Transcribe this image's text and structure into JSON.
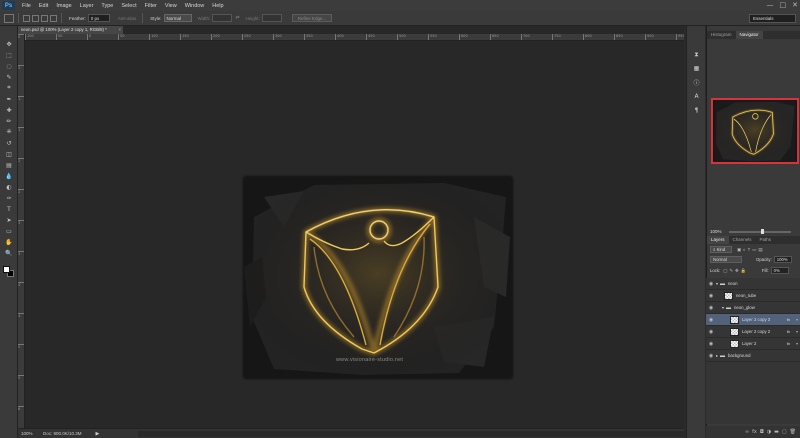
{
  "app": {
    "logo": "Ps",
    "window_controls": [
      "—",
      "□",
      "✕"
    ]
  },
  "menu": [
    "File",
    "Edit",
    "Image",
    "Layer",
    "Type",
    "Select",
    "Filter",
    "View",
    "Window",
    "Help"
  ],
  "options_bar": {
    "feather_label": "Feather:",
    "feather_value": "0 px",
    "anti_alias_label": "Anti-alias",
    "style_label": "Style:",
    "style_value": "Normal",
    "width_label": "Width:",
    "height_label": "Height:",
    "refine_edge_label": "Refine Edge...",
    "workspace": "Essentials"
  },
  "document": {
    "tab_title": "neon.psd @ 100% (Layer 2 copy 1, RGB/8) *",
    "watermark": "www.visionaire-studio.net",
    "zoom": "100%",
    "doc_size": "Doc: 900.0K/10.3M"
  },
  "ruler_top_labels": [
    "100",
    "50",
    "0",
    "50",
    "100",
    "150",
    "200",
    "250",
    "300",
    "350",
    "400",
    "450",
    "500",
    "550",
    "600",
    "650",
    "700",
    "750",
    "800",
    "850",
    "900",
    "950"
  ],
  "ruler_left_labels": [
    "0",
    "5",
    "1",
    "1",
    "2",
    "2",
    "3",
    "3",
    "4",
    "4",
    "5",
    "5",
    "6"
  ],
  "tools": [
    "move-tool-icon",
    "marquee-tool-icon",
    "lasso-tool-icon",
    "quick-select-tool-icon",
    "crop-tool-icon",
    "eyedropper-tool-icon",
    "healing-brush-tool-icon",
    "brush-tool-icon",
    "clone-stamp-tool-icon",
    "history-brush-tool-icon",
    "eraser-tool-icon",
    "gradient-tool-icon",
    "blur-tool-icon",
    "dodge-tool-icon",
    "pen-tool-icon",
    "type-tool-icon",
    "path-select-tool-icon",
    "shape-tool-icon",
    "hand-tool-icon",
    "zoom-tool-icon"
  ],
  "tool_glyphs": [
    "✥",
    "⬚",
    "◌",
    "✎",
    "⌗",
    "✒",
    "✚",
    "✏",
    "⎈",
    "↺",
    "◫",
    "▤",
    "💧",
    "◐",
    "✑",
    "T",
    "➤",
    "▭",
    "✋",
    "🔍"
  ],
  "panels": {
    "nav_tabs": [
      "Histogram",
      "Navigator"
    ],
    "nav_zoom": "100%",
    "layer_tabs": [
      "Layers",
      "Channels",
      "Paths"
    ],
    "kind_label": "Kind",
    "blend_mode": "Normal",
    "opacity_label": "Opacity:",
    "opacity_value": "100%",
    "lock_label": "Lock:",
    "fill_label": "Fill:",
    "fill_value": "0%"
  },
  "layers": [
    {
      "name": "neon",
      "type": "group",
      "fx": ""
    },
    {
      "name": "neon_tube",
      "type": "layer",
      "fx": ""
    },
    {
      "name": "neon_glow",
      "type": "group",
      "fx": ""
    },
    {
      "name": "Layer 2 copy 3",
      "type": "layer",
      "fx": "fx"
    },
    {
      "name": "Layer 2 copy 2",
      "type": "layer",
      "fx": "fx"
    },
    {
      "name": "Layer 2",
      "type": "layer",
      "fx": "fx"
    },
    {
      "name": "background",
      "type": "group",
      "fx": ""
    }
  ],
  "colors": {
    "accent_navigator": "#d9323a",
    "selection": "#51627a",
    "neon": "#e0b844"
  }
}
